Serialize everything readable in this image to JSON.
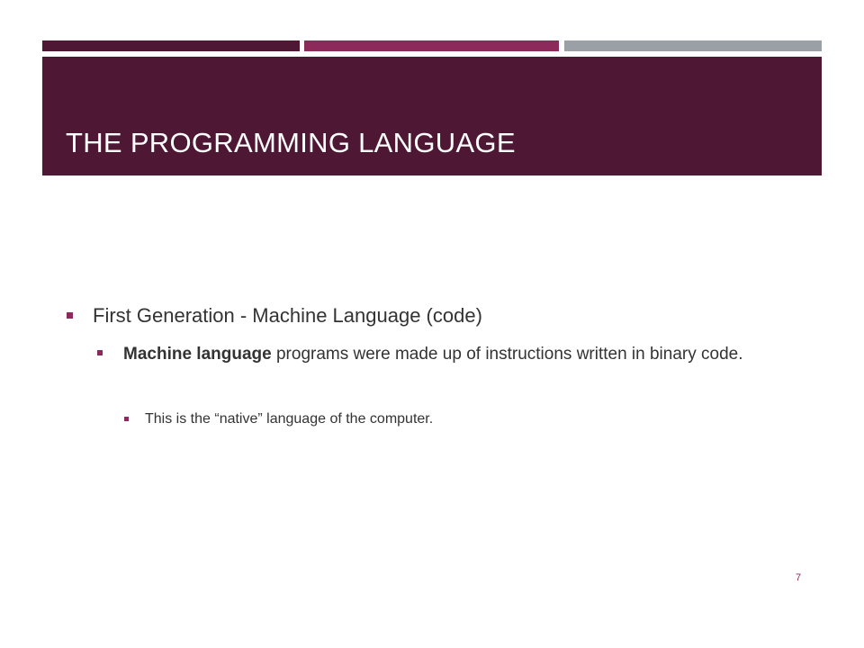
{
  "colors": {
    "title_band": "#4e1835",
    "bar_1": "#4e1835",
    "bar_2": "#8c2a5b",
    "bar_3": "#9aa0a6",
    "bullet": "#8c2a5b",
    "text": "#333333",
    "page_number": "#8c2a5b"
  },
  "slide": {
    "title": "THE PROGRAMMING LANGUAGE",
    "bullet_1": "First Generation - Machine Language (code)",
    "bullet_2_bold": "Machine language",
    "bullet_2_rest": " programs were made up of instructions written in binary code.",
    "bullet_3": "This is the “native” language of the computer.",
    "page_number": "7"
  }
}
